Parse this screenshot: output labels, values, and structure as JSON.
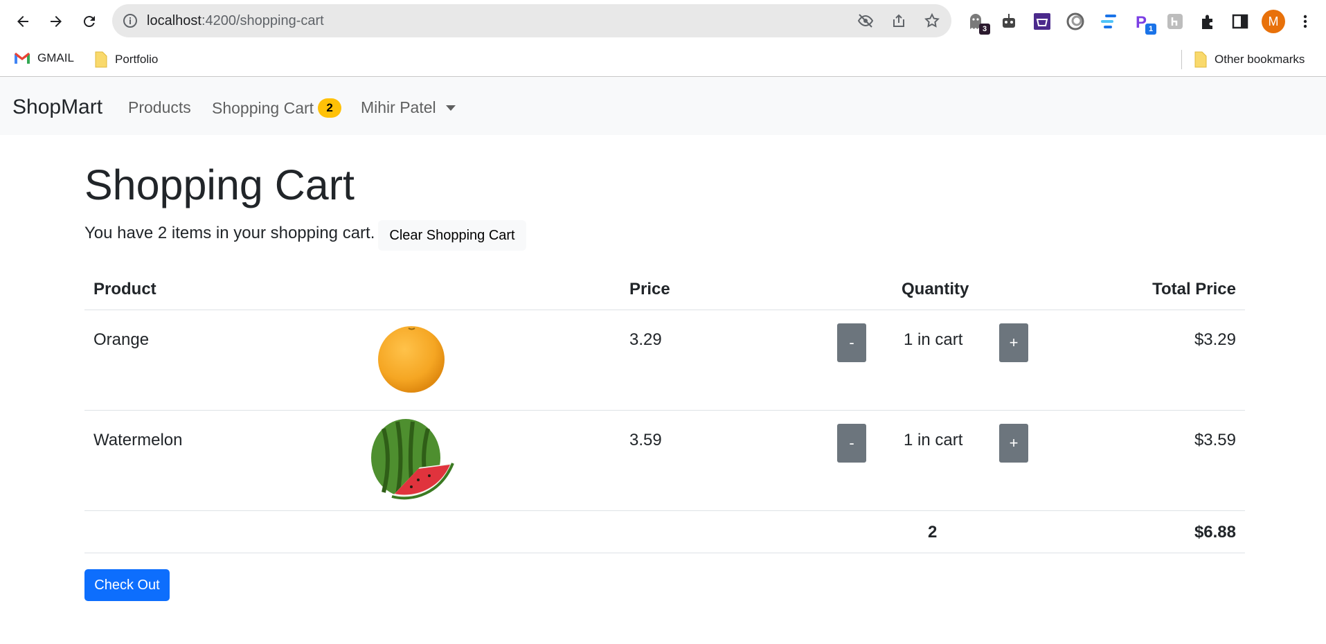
{
  "browser": {
    "url_host": "localhost",
    "url_path": ":4200/shopping-cart",
    "extension_badges": [
      "3",
      "1"
    ],
    "profile_initial": "M",
    "bookmarks": [
      "GMAIL",
      "Portfolio"
    ],
    "other_bookmarks": "Other bookmarks"
  },
  "navbar": {
    "brand": "ShopMart",
    "links": [
      "Products",
      "Shopping Cart"
    ],
    "cart_count": "2",
    "user": "Mihir Patel"
  },
  "page": {
    "title": "Shopping Cart",
    "summary": "You have 2 items in your shopping cart.",
    "clear_label": "Clear Shopping Cart",
    "checkout_label": "Check Out"
  },
  "table": {
    "headers": [
      "Product",
      "Price",
      "Quantity",
      "Total Price"
    ],
    "rows": [
      {
        "name": "Orange",
        "price": "3.29",
        "minus": "-",
        "qty": "1 in cart",
        "plus": "+",
        "total": "$3.29",
        "image": "orange"
      },
      {
        "name": "Watermelon",
        "price": "3.59",
        "minus": "-",
        "qty": "1 in cart",
        "plus": "+",
        "total": "$3.59",
        "image": "watermelon"
      }
    ],
    "footer": {
      "qty_total": "2",
      "grand_total": "$6.88"
    }
  },
  "colors": {
    "primary": "#0d6efd",
    "secondary": "#6c757d",
    "warning": "#ffc107",
    "navbar_bg": "#f8f9fa"
  }
}
